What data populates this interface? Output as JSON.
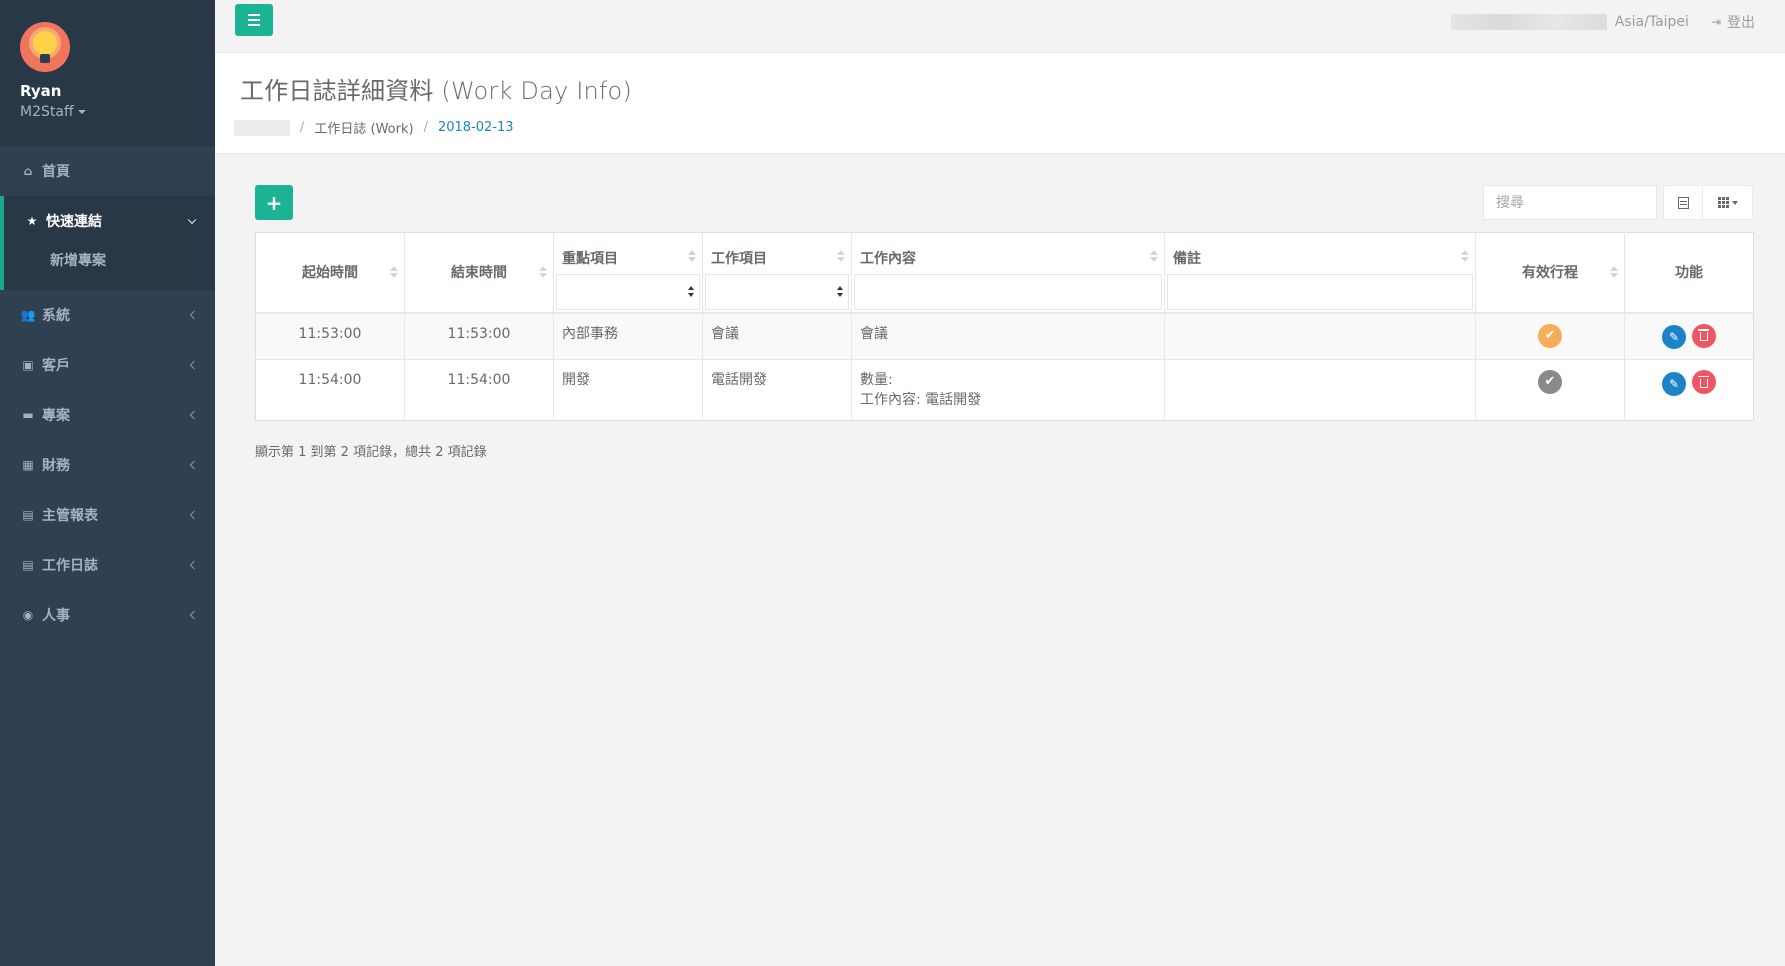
{
  "sidebar": {
    "profile": {
      "name": "Ryan",
      "role": "M2Staff"
    },
    "items": [
      {
        "label": "首頁",
        "icon": "home-icon"
      },
      {
        "label": "快速連結",
        "icon": "star-icon",
        "expanded": true,
        "children": [
          "新增專案"
        ]
      },
      {
        "label": "系統",
        "icon": "users-icon"
      },
      {
        "label": "客戶",
        "icon": "address-book-icon"
      },
      {
        "label": "專案",
        "icon": "briefcase-icon"
      },
      {
        "label": "財務",
        "icon": "calculator-icon"
      },
      {
        "label": "主管報表",
        "icon": "file-icon"
      },
      {
        "label": "工作日誌",
        "icon": "file-icon"
      },
      {
        "label": "人事",
        "icon": "user-circle-icon"
      }
    ]
  },
  "topbar": {
    "timezone": "Asia/Taipei",
    "logout_label": "登出"
  },
  "heading": {
    "title": "工作日誌詳細資料 (Work Day Info)",
    "breadcrumb": [
      "工作日誌 (Work)",
      "2018-02-13"
    ]
  },
  "toolbar": {
    "add_label": "+",
    "search_placeholder": "搜尋"
  },
  "table": {
    "headers": [
      "起始時間",
      "結束時間",
      "重點項目",
      "工作項目",
      "工作內容",
      "備註",
      "有效行程",
      "功能"
    ],
    "rows": [
      {
        "start": "11:53:00",
        "end": "11:53:00",
        "focus": "內部事務",
        "task": "會議",
        "content_line1": "會議",
        "content_line2": "",
        "note": "",
        "valid": true
      },
      {
        "start": "11:54:00",
        "end": "11:54:00",
        "focus": "開發",
        "task": "電話開發",
        "content_line1": "數量:",
        "content_line2": "工作內容: 電話開發",
        "note": "",
        "valid": false
      }
    ]
  },
  "pagination": {
    "info": "顯示第 1 到第 2 項記錄，總共 2 項記錄"
  },
  "colors": {
    "sidebar": "#2f4050",
    "accent": "#1ab394",
    "link": "#1c84c6",
    "warning": "#f8ac59",
    "danger": "#ed5565"
  }
}
